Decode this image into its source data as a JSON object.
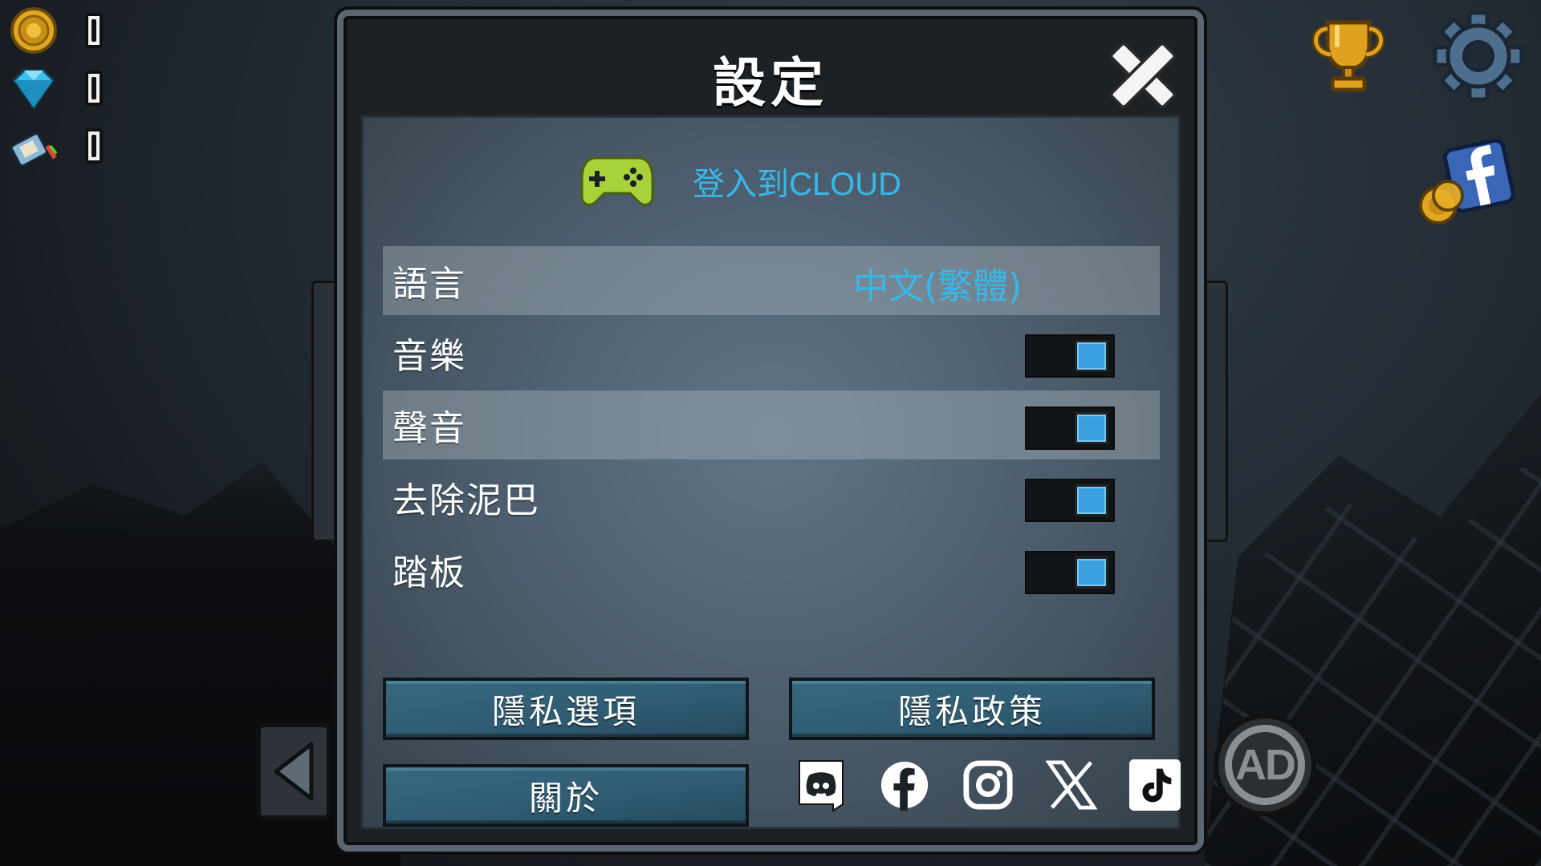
{
  "hud": {
    "coins": {
      "icon": "coin-icon",
      "value": "0"
    },
    "gems": {
      "icon": "gem-icon",
      "value": "0"
    },
    "fuel": {
      "icon": "fuel-can-icon",
      "value": "0"
    }
  },
  "right_hud": {
    "trophy": "trophy-icon",
    "settings": "gear-icon",
    "facebook_promo": "facebook-coin-icon",
    "ad": {
      "label": "AD",
      "icon": "ad-refresh-icon"
    },
    "back": "back-arrow-icon"
  },
  "dialog": {
    "title": "設定",
    "close_icon": "close-icon",
    "cloud_login": {
      "icon": "gamepad-icon",
      "label": "登入到CLOUD"
    },
    "settings": [
      {
        "label": "語言",
        "value": "中文(繁體)"
      },
      {
        "label": "音樂",
        "toggle": true
      },
      {
        "label": "聲音",
        "toggle": true
      },
      {
        "label": "去除泥巴",
        "toggle": true
      },
      {
        "label": "踏板",
        "toggle": true
      }
    ],
    "buttons": {
      "privacy_options": "隱私選項",
      "privacy_policy": "隱私政策",
      "about": "關於"
    },
    "social": [
      "discord-icon",
      "facebook-icon",
      "instagram-icon",
      "x-icon",
      "tiktok-icon"
    ]
  },
  "colors": {
    "accent_blue": "#38b8ea",
    "toggle_on": "#3aa0e0",
    "gamepad_green": "#a8d23a",
    "button_teal": "#2f5c72"
  }
}
